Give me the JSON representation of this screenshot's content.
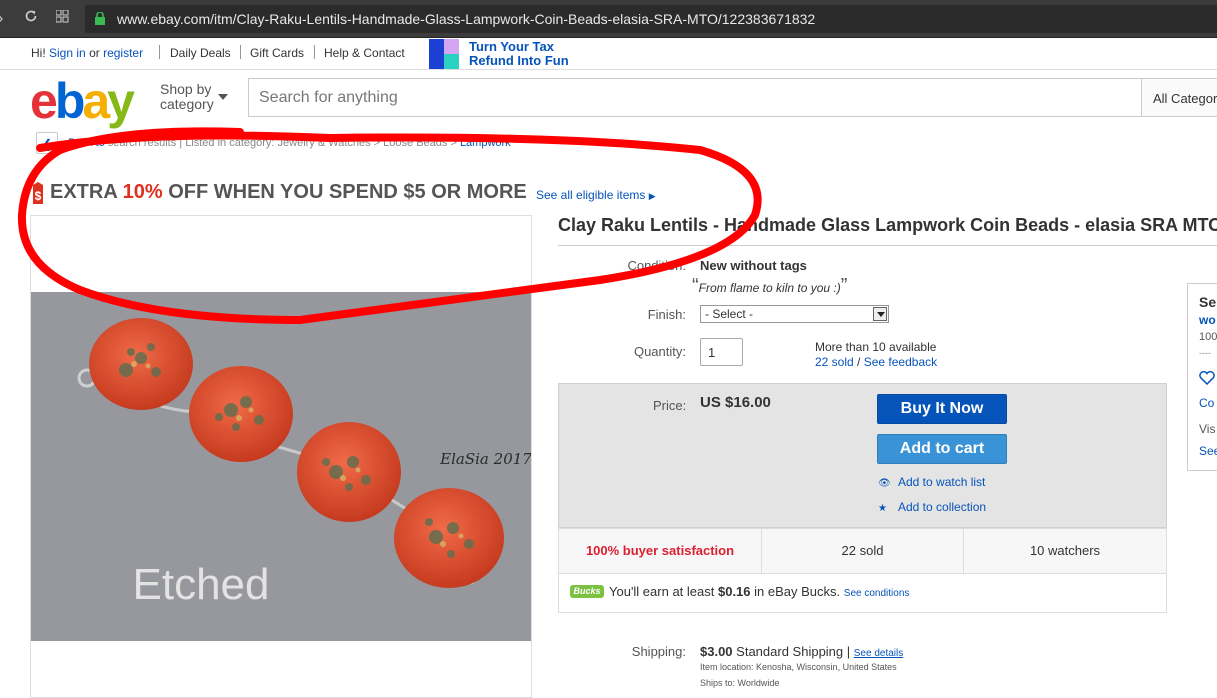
{
  "browser": {
    "url": "www.ebay.com/itm/Clay-Raku-Lentils-Handmade-Glass-Lampwork-Coin-Beads-elasia-SRA-MTO/122383671832",
    "icons": [
      "back-icon",
      "reload-icon",
      "apps-icon",
      "lock-icon"
    ]
  },
  "topbar": {
    "greeting": "Hi!",
    "sign_in": "Sign in",
    "or": "or",
    "register": "register",
    "daily_deals": "Daily Deals",
    "gift_cards": "Gift Cards",
    "help": "Help & Contact",
    "promo_line1": "Turn Your Tax",
    "promo_line2": "Refund Into Fun"
  },
  "header": {
    "logo": [
      "e",
      "b",
      "a",
      "y"
    ],
    "logo_colors": [
      "#e53238",
      "#0064d2",
      "#f5af02",
      "#86b817"
    ],
    "shop_by_line1": "Shop by",
    "shop_by_line2": "category",
    "search_placeholder": "Search for anything",
    "category": "All Categories"
  },
  "breadcrumb": {
    "back": "Back to",
    "trail": "search results | Listed in category: Jewelry & Watches > Loose Beads >",
    "last": "Lampwork"
  },
  "promo": {
    "part1": "EXTRA",
    "part2": "10%",
    "part3": "OFF WHEN YOU SPEND $5 OR MORE",
    "link": "See all eligible items"
  },
  "product": {
    "title": "Clay Raku Lentils - Handmade Glass Lampwork Coin Beads - elasia SRA MTO",
    "photo_caption": "Etched",
    "signature": "ElaSia 2017",
    "condition_label": "Condition:",
    "condition": "New without tags",
    "condition_note": "From flame to kiln to you :)",
    "finish_label": "Finish:",
    "finish_value": "- Select -",
    "quantity_label": "Quantity:",
    "quantity": "1",
    "available": "More than 10 available",
    "sold_link": "22 sold",
    "slash": "/",
    "feedback_link": "See feedback",
    "price_label": "Price:",
    "price": "US $16.00",
    "buy_now": "Buy It Now",
    "add_to_cart": "Add to cart",
    "watch": "Add to watch list",
    "collection": "Add to collection"
  },
  "stats": {
    "satisfaction": "100% buyer satisfaction",
    "sold": "22 sold",
    "watchers": "10 watchers"
  },
  "bucks": {
    "logo": "Bucks",
    "text_pre": "You'll earn at least",
    "amount": "$0.16",
    "text_post": "in eBay Bucks.",
    "conditions": "See conditions"
  },
  "shipping": {
    "label": "Shipping:",
    "cost": "$3.00",
    "method": "Standard Shipping",
    "details": "See details",
    "location": "Item location:  Kenosha, Wisconsin, United States",
    "ships_to": "Ships to:  Worldwide"
  },
  "seller": {
    "l1": "Se",
    "l2": "wo",
    "l3": "100",
    "l4": "----",
    "l5": "Co",
    "l6": "Vis",
    "l7": "See"
  },
  "colors": {
    "link": "#0654ba",
    "red": "#e0311f",
    "annotation": "#ff0000",
    "bead": "#e0583a"
  }
}
